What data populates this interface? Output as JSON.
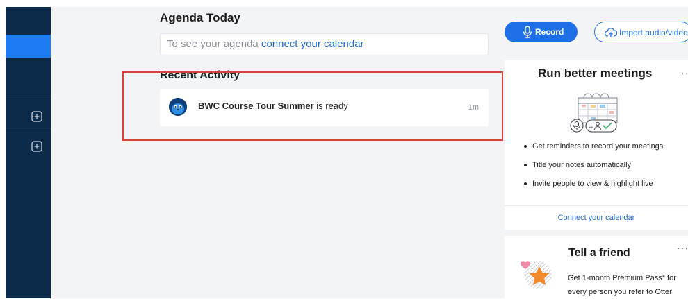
{
  "main": {
    "agenda": {
      "title": "Agenda Today",
      "prompt": "To see your agenda",
      "link": "connect your calendar"
    },
    "recent": {
      "title": "Recent Activity",
      "items": [
        {
          "name": "BWC Course Tour Summer",
          "status": "is ready",
          "time": "1m"
        }
      ]
    }
  },
  "actions": {
    "record_label": "Record",
    "import_label": "Import audio/video"
  },
  "promo_meetings": {
    "title": "Run better meetings",
    "bullets": [
      "Get reminders to record your meetings",
      "Title your notes automatically",
      "Invite people to view & highlight live"
    ],
    "cta": "Connect your calendar"
  },
  "promo_friend": {
    "title": "Tell a friend",
    "description": "Get 1-month Premium Pass* for every person you refer to Otter"
  },
  "colors": {
    "sidebar": "#0c2b4a",
    "accent": "#1e6fe6",
    "highlight_frame": "#d6443a"
  }
}
